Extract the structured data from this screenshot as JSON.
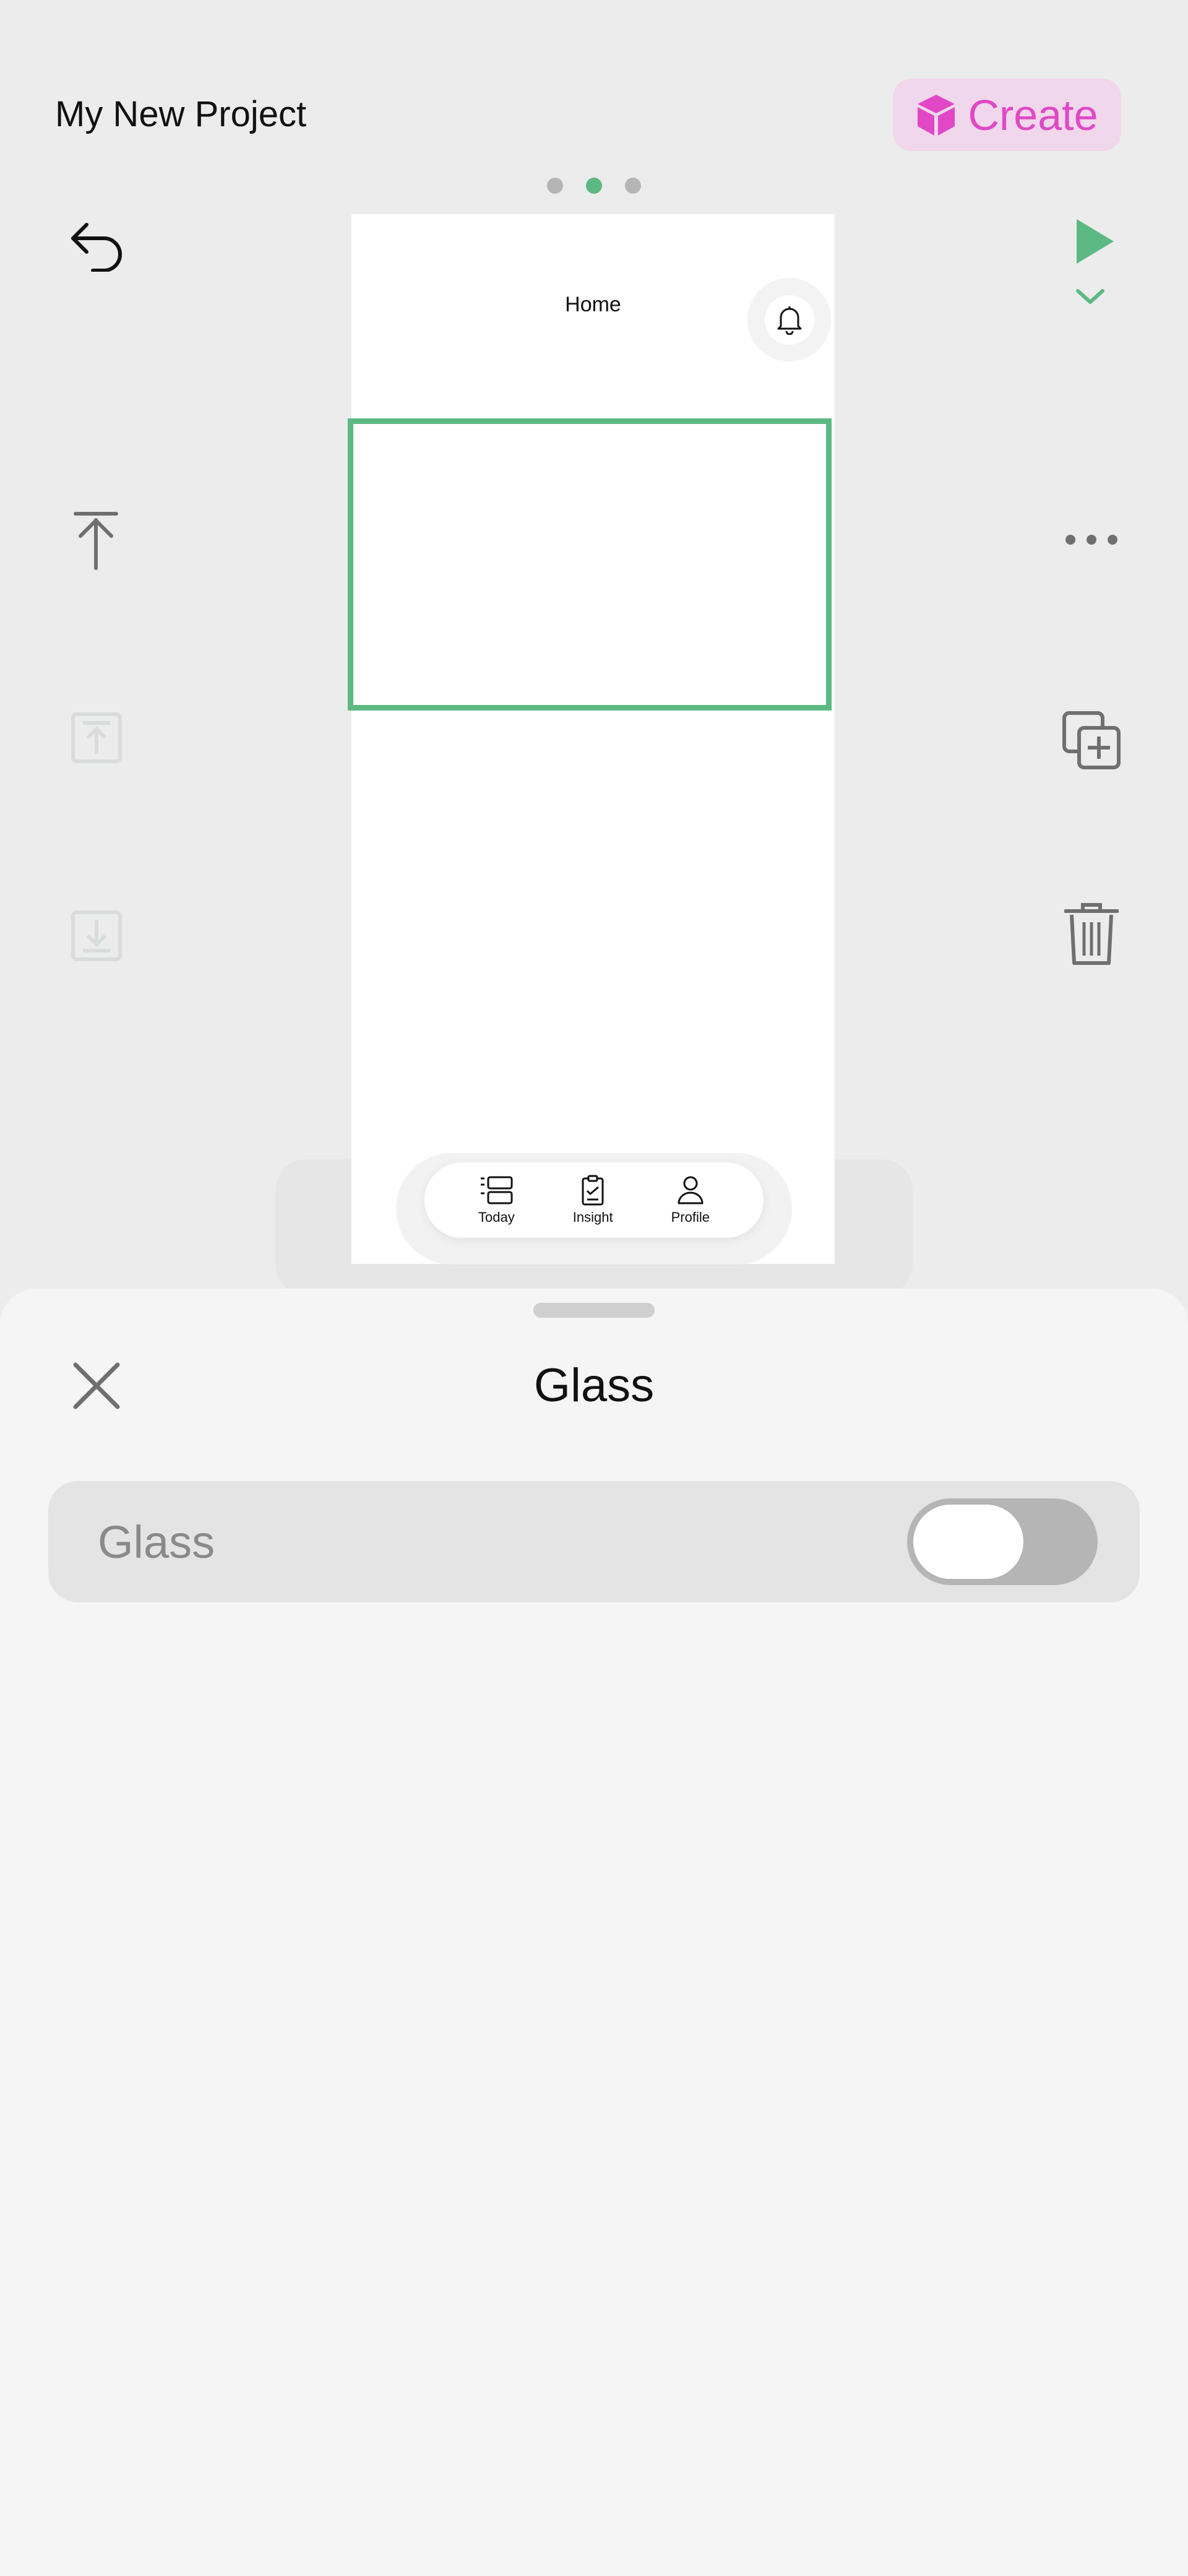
{
  "header": {
    "project_title": "My New Project",
    "create_label": "Create",
    "accent": "#e048c6",
    "page_dots": {
      "count": 3,
      "active_index": 1
    }
  },
  "toolbar": {
    "left": [
      "undo-icon",
      "move-to-top-icon",
      "bring-forward-icon",
      "send-backward-icon"
    ],
    "right": [
      "play-icon",
      "chevron-down-icon",
      "more-icon",
      "duplicate-icon",
      "trash-icon"
    ],
    "accent": "#5db983"
  },
  "phone": {
    "title": "Home",
    "tabs": [
      {
        "label": "Today",
        "icon": "list-icon"
      },
      {
        "label": "Insight",
        "icon": "clipboard-icon"
      },
      {
        "label": "Profile",
        "icon": "person-icon"
      }
    ]
  },
  "sheet": {
    "title": "Glass",
    "toggle_row": {
      "label": "Glass",
      "value": false
    }
  }
}
